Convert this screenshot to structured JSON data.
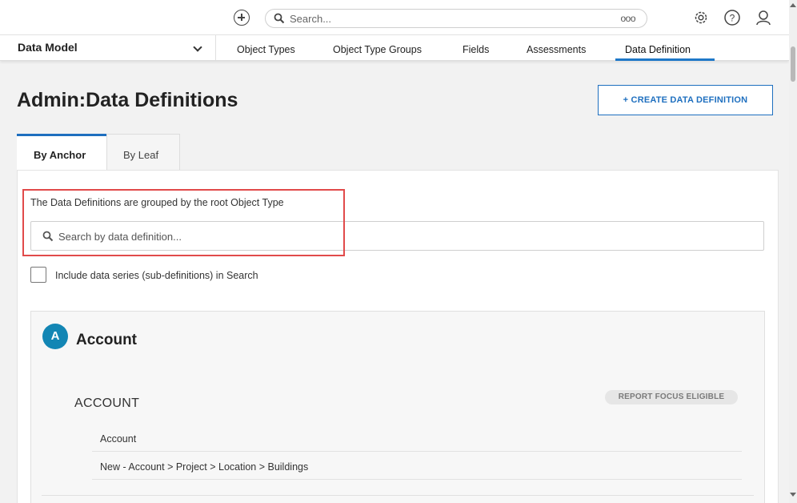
{
  "topbar": {
    "search_placeholder": "Search...",
    "more_label": "ooo",
    "icons": [
      "plus-circle-icon",
      "search-icon",
      "settings-icon",
      "help-icon",
      "user-icon"
    ]
  },
  "navbar": {
    "module_select": "Data Model",
    "tabs": [
      {
        "label": "Object Types"
      },
      {
        "label": "Object Type Groups"
      },
      {
        "label": "Fields"
      },
      {
        "label": "Assessments"
      },
      {
        "label": "Data Definition",
        "active": true
      }
    ]
  },
  "page": {
    "title": "Admin:Data Definitions",
    "create_button": "+ CREATE DATA DEFINITION"
  },
  "view_tabs": [
    {
      "label": "By Anchor",
      "active": true
    },
    {
      "label": "By Leaf"
    }
  ],
  "filter": {
    "description": "The Data Definitions are grouped by the root Object Type",
    "search_placeholder": "Search by data definition...",
    "include_series_label": "Include data series (sub-definitions) in Search",
    "include_series_checked": false
  },
  "groups": [
    {
      "avatar_letter": "A",
      "title": "Account",
      "sections": [
        {
          "name": "ACCOUNT",
          "badge": "REPORT FOCUS ELIGIBLE",
          "definitions": [
            "Account",
            "New - Account > Project > Location > Buildings"
          ]
        }
      ]
    }
  ],
  "colors": {
    "accent": "#1e6fbf",
    "avatar": "#1386b4",
    "highlight_box": "#e14a4a"
  }
}
